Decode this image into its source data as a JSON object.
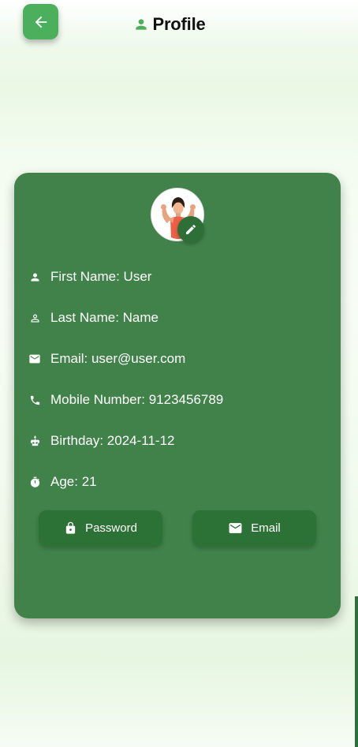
{
  "header": {
    "title": "Profile"
  },
  "profile": {
    "first_name": "First Name: User",
    "last_name": "Last Name: Name",
    "email": "Email: user@user.com",
    "mobile": "Mobile Number: 9123456789",
    "birthday": "Birthday: 2024-11-12",
    "age": "Age: 21"
  },
  "actions": {
    "password_label": "Password",
    "email_label": "Email"
  },
  "icons": {
    "back": "arrow-back-icon",
    "header": "person-icon",
    "edit": "pencil-icon",
    "first_name": "person-icon",
    "last_name": "person-outline-icon",
    "email": "mail-icon",
    "mobile": "phone-icon",
    "birthday": "cake-icon",
    "age": "timer-icon",
    "password": "lock-icon",
    "email_button": "mail-icon"
  },
  "colors": {
    "accent": "#4caf5c",
    "card": "#41824a",
    "button": "#2c7135",
    "text_on_card": "#ffffff"
  }
}
